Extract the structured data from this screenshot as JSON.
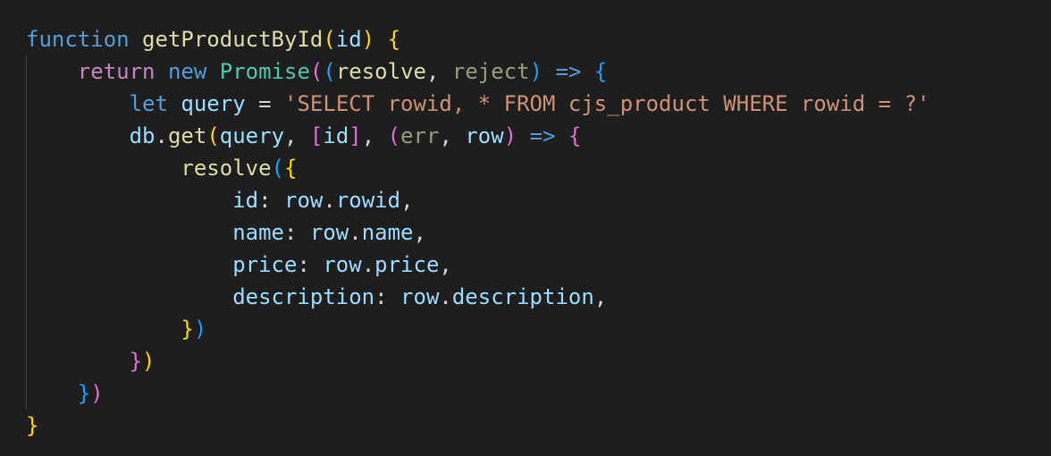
{
  "editor": {
    "lines": [
      {
        "indent": 0,
        "tokens": [
          {
            "t": "function",
            "c": "kw"
          },
          {
            "t": " ",
            "c": "plain"
          },
          {
            "t": "getProductById",
            "c": "fn"
          },
          {
            "t": "(",
            "c": "b1"
          },
          {
            "t": "id",
            "c": "var"
          },
          {
            "t": ")",
            "c": "b1"
          },
          {
            "t": " ",
            "c": "plain"
          },
          {
            "t": "{",
            "c": "b1"
          }
        ]
      },
      {
        "indent": 1,
        "tokens": [
          {
            "t": "return",
            "c": "ctrl"
          },
          {
            "t": " ",
            "c": "plain"
          },
          {
            "t": "new",
            "c": "kw"
          },
          {
            "t": " ",
            "c": "plain"
          },
          {
            "t": "Promise",
            "c": "cls"
          },
          {
            "t": "(",
            "c": "b2"
          },
          {
            "t": "(",
            "c": "b3"
          },
          {
            "t": "resolve",
            "c": "fn"
          },
          {
            "t": ", ",
            "c": "plain"
          },
          {
            "t": "reject",
            "c": "param-dim"
          },
          {
            "t": ")",
            "c": "b3"
          },
          {
            "t": " ",
            "c": "plain"
          },
          {
            "t": "=>",
            "c": "kw"
          },
          {
            "t": " ",
            "c": "plain"
          },
          {
            "t": "{",
            "c": "b3"
          }
        ]
      },
      {
        "indent": 2,
        "tokens": [
          {
            "t": "let",
            "c": "kw"
          },
          {
            "t": " ",
            "c": "plain"
          },
          {
            "t": "query",
            "c": "var"
          },
          {
            "t": " = ",
            "c": "plain"
          },
          {
            "t": "'SELECT rowid, * FROM cjs_product WHERE rowid = ?'",
            "c": "str"
          }
        ]
      },
      {
        "indent": 2,
        "tokens": [
          {
            "t": "db",
            "c": "var"
          },
          {
            "t": ".",
            "c": "plain"
          },
          {
            "t": "get",
            "c": "fn"
          },
          {
            "t": "(",
            "c": "b1"
          },
          {
            "t": "query",
            "c": "var"
          },
          {
            "t": ", ",
            "c": "plain"
          },
          {
            "t": "[",
            "c": "b2"
          },
          {
            "t": "id",
            "c": "var"
          },
          {
            "t": "]",
            "c": "b2"
          },
          {
            "t": ", ",
            "c": "plain"
          },
          {
            "t": "(",
            "c": "b2"
          },
          {
            "t": "err",
            "c": "param-dim"
          },
          {
            "t": ", ",
            "c": "plain"
          },
          {
            "t": "row",
            "c": "var"
          },
          {
            "t": ")",
            "c": "b2"
          },
          {
            "t": " ",
            "c": "plain"
          },
          {
            "t": "=>",
            "c": "kw"
          },
          {
            "t": " ",
            "c": "plain"
          },
          {
            "t": "{",
            "c": "b2"
          }
        ]
      },
      {
        "indent": 3,
        "tokens": [
          {
            "t": "resolve",
            "c": "fn"
          },
          {
            "t": "(",
            "c": "b3"
          },
          {
            "t": "{",
            "c": "b1"
          }
        ]
      },
      {
        "indent": 4,
        "tokens": [
          {
            "t": "id",
            "c": "var"
          },
          {
            "t": ": ",
            "c": "plain"
          },
          {
            "t": "row",
            "c": "var"
          },
          {
            "t": ".",
            "c": "plain"
          },
          {
            "t": "rowid",
            "c": "var"
          },
          {
            "t": ",",
            "c": "plain"
          }
        ]
      },
      {
        "indent": 4,
        "tokens": [
          {
            "t": "name",
            "c": "var"
          },
          {
            "t": ": ",
            "c": "plain"
          },
          {
            "t": "row",
            "c": "var"
          },
          {
            "t": ".",
            "c": "plain"
          },
          {
            "t": "name",
            "c": "var"
          },
          {
            "t": ",",
            "c": "plain"
          }
        ]
      },
      {
        "indent": 4,
        "tokens": [
          {
            "t": "price",
            "c": "var"
          },
          {
            "t": ": ",
            "c": "plain"
          },
          {
            "t": "row",
            "c": "var"
          },
          {
            "t": ".",
            "c": "plain"
          },
          {
            "t": "price",
            "c": "var"
          },
          {
            "t": ",",
            "c": "plain"
          }
        ]
      },
      {
        "indent": 4,
        "tokens": [
          {
            "t": "description",
            "c": "var"
          },
          {
            "t": ": ",
            "c": "plain"
          },
          {
            "t": "row",
            "c": "var"
          },
          {
            "t": ".",
            "c": "plain"
          },
          {
            "t": "description",
            "c": "var"
          },
          {
            "t": ",",
            "c": "plain"
          }
        ]
      },
      {
        "indent": 3,
        "tokens": [
          {
            "t": "}",
            "c": "b1"
          },
          {
            "t": ")",
            "c": "b3"
          }
        ]
      },
      {
        "indent": 2,
        "tokens": [
          {
            "t": "}",
            "c": "b2"
          },
          {
            "t": ")",
            "c": "b1"
          }
        ]
      },
      {
        "indent": 1,
        "tokens": [
          {
            "t": "}",
            "c": "b3"
          },
          {
            "t": ")",
            "c": "b2"
          }
        ]
      },
      {
        "indent": 0,
        "tokens": [
          {
            "t": "}",
            "c": "b1"
          }
        ]
      }
    ]
  },
  "colors": {
    "background": "#1e1e1e",
    "keyword": "#569cd6",
    "control": "#c586c0",
    "function": "#dcdcaa",
    "class": "#4ec9b0",
    "variable": "#9cdcfe",
    "string": "#ce9178",
    "bracket_1": "#ffd700",
    "bracket_2": "#da70d6",
    "bracket_3": "#179fff"
  }
}
